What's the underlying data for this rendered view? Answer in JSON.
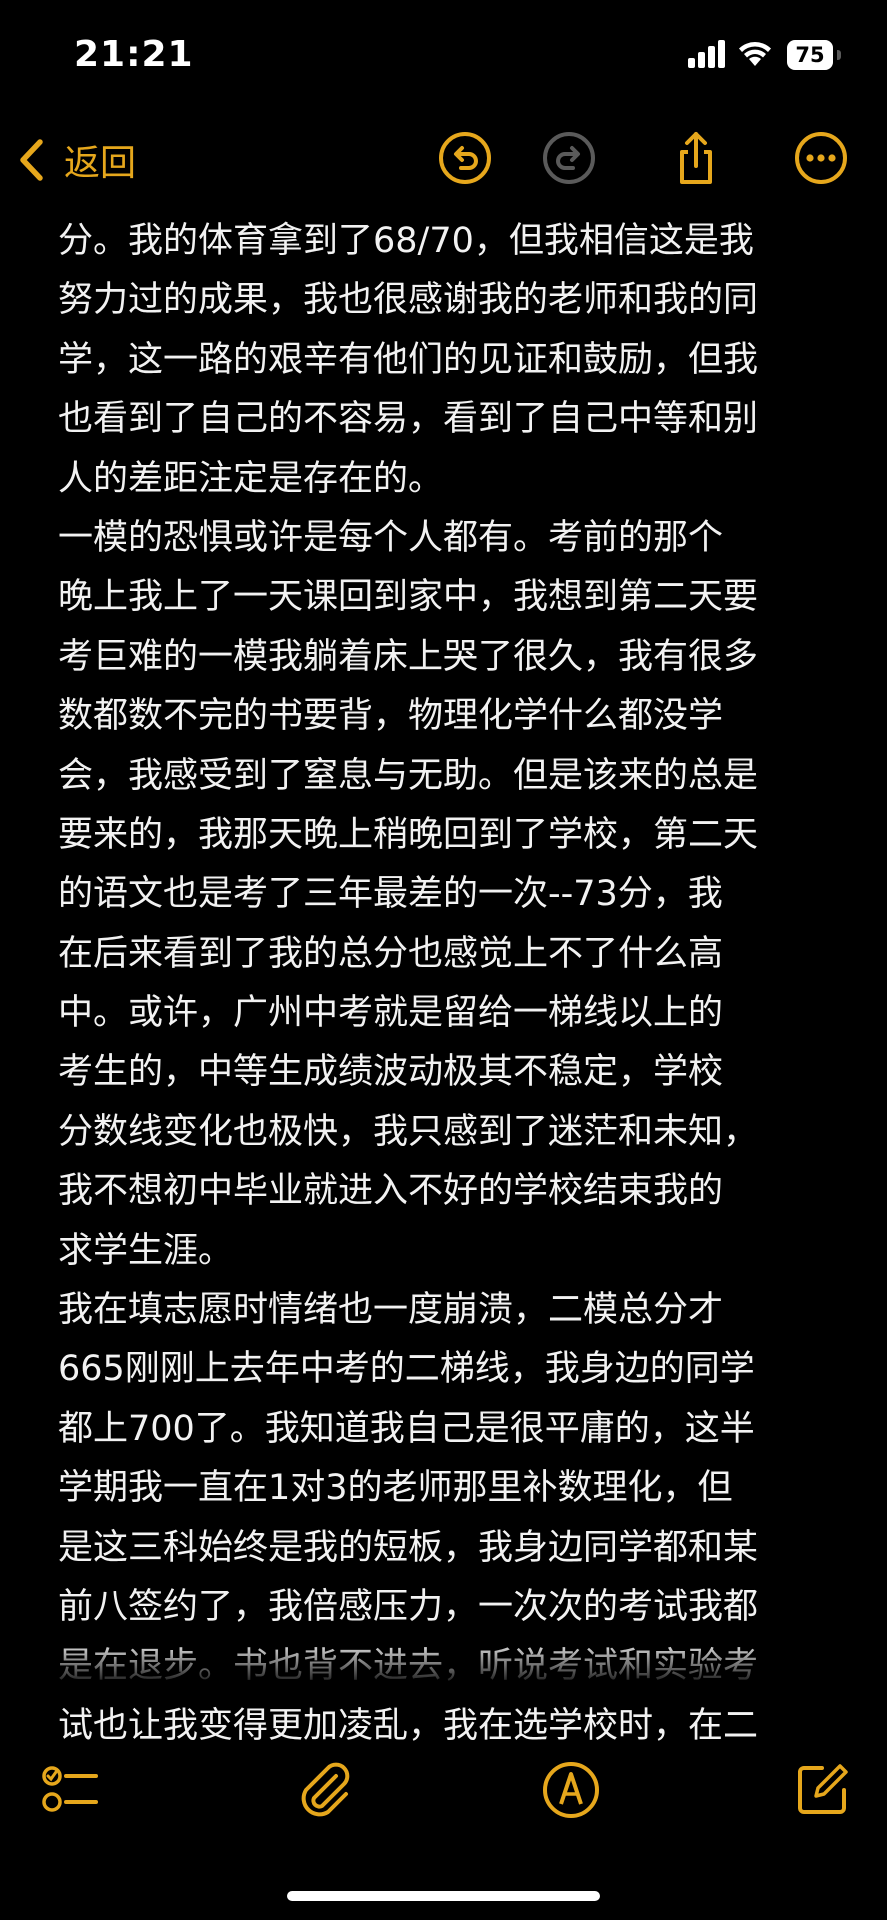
{
  "status_bar": {
    "time": "21:21",
    "battery": "75",
    "battery_level": 0.75
  },
  "toolbar": {
    "back_label": "返回"
  },
  "colors": {
    "accent": "#e6a71c",
    "background": "#000000",
    "text": "#f2f2f2"
  },
  "icons": {
    "back": "chevron-left-icon",
    "undo": "undo-icon",
    "redo": "redo-icon",
    "share": "share-icon",
    "more": "more-icon",
    "checklist": "checklist-icon",
    "attach": "paperclip-icon",
    "markup": "pen-icon",
    "compose": "compose-icon"
  },
  "note": {
    "lines": [
      "分。我的体育拿到了68/70，但我相信这是我",
      "努力过的成果，我也很感谢我的老师和我的同",
      "学，这一路的艰辛有他们的见证和鼓励，但我",
      "也看到了自己的不容易，看到了自己中等和别",
      "人的差距注定是存在的。",
      " 一模的恐惧或许是每个人都有。考前的那个",
      "晚上我上了一天课回到家中，我想到第二天要",
      "考巨难的一模我躺着床上哭了很久，我有很多",
      "数都数不完的书要背，物理化学什么都没学",
      "会，我感受到了窒息与无助。但是该来的总是",
      "要来的，我那天晚上稍晚回到了学校，第二天",
      "的语文也是考了三年最差的一次--73分，我",
      "在后来看到了我的总分也感觉上不了什么高",
      "中。或许，广州中考就是留给一梯线以上的",
      "考生的，中等生成绩波动极其不稳定，学校",
      "分数线变化也极快，我只感到了迷茫和未知，",
      "我不想初中毕业就进入不好的学校结束我的",
      "求学生涯。",
      " 我在填志愿时情绪也一度崩溃，二模总分才",
      " 665刚刚上去年中考的二梯线，我身边的同学",
      "都上700了。我知道我自己是很平庸的，这半",
      "学期我一直在1对3的老师那里补数理化，但",
      "是这三科始终是我的短板，我身边同学都和某",
      "前八签约了，我倍感压力，一次次的考试我都",
      "是在退步。书也背不进去，听说考试和实验考",
      "试也让我变得更加凌乱，我在选学校时，在二"
    ]
  }
}
